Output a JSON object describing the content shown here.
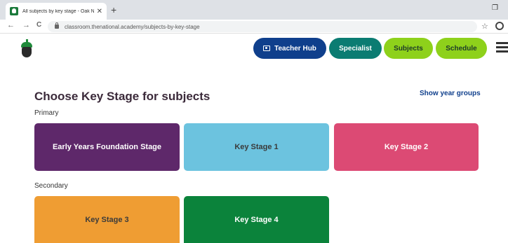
{
  "browser": {
    "tab_title": "All subjects by key stage - Oak N",
    "tab_close": "✕",
    "new_tab": "+",
    "window_control": "❐",
    "nav": {
      "back": "←",
      "forward": "→",
      "reload": "C"
    },
    "url": "classroom.thenational.academy/subjects-by-key-stage",
    "bookmark_star": "☆"
  },
  "header": {
    "logo_icon": "acorn-icon",
    "nav": [
      {
        "label": "Teacher Hub",
        "color": "#0f3f8c"
      },
      {
        "label": "Specialist",
        "color": "#0b7c72"
      },
      {
        "label": "Subjects",
        "color": "#8ed11b"
      },
      {
        "label": "Schedule",
        "color": "#8ed11b"
      }
    ],
    "menu_icon": "hamburger-menu-icon"
  },
  "main": {
    "title": "Choose Key Stage for subjects",
    "show_year_groups": "Show year groups",
    "sections": [
      {
        "label": "Primary",
        "cards": [
          {
            "label": "Early Years Foundation Stage",
            "color": "#5e286a"
          },
          {
            "label": "Key Stage 1",
            "color": "#6cc3df"
          },
          {
            "label": "Key Stage 2",
            "color": "#dc4a74"
          }
        ]
      },
      {
        "label": "Secondary",
        "cards": [
          {
            "label": "Key Stage 3",
            "color": "#ef9d33"
          },
          {
            "label": "Key Stage 4",
            "color": "#0b833b"
          }
        ]
      }
    ]
  }
}
